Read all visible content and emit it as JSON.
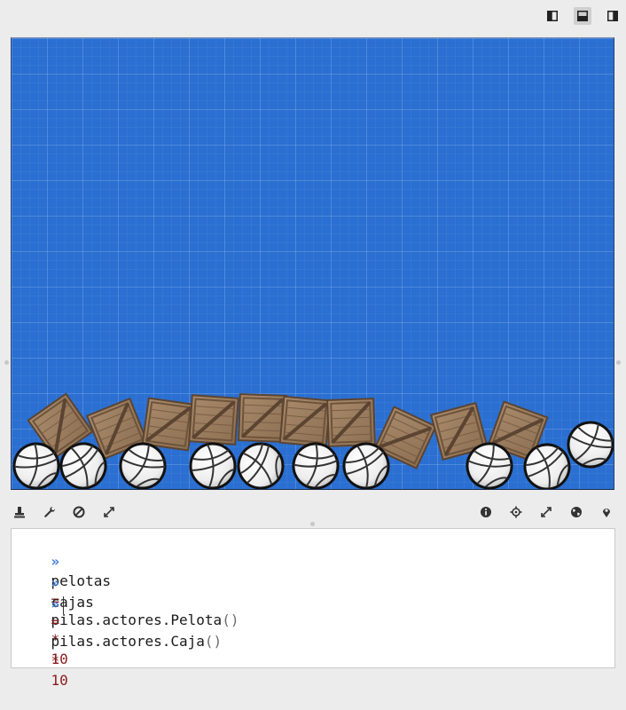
{
  "layout_buttons": [
    {
      "name": "layout-left-panel-icon",
      "active": false
    },
    {
      "name": "layout-bottom-panel-icon",
      "active": true
    },
    {
      "name": "layout-right-panel-icon",
      "active": false
    }
  ],
  "canvas": {
    "background_color": "#2a6fd1",
    "balls": 10,
    "boxes": 10
  },
  "toolbar_left": [
    "stamp-icon",
    "wrench-icon",
    "block-icon",
    "expand-icon"
  ],
  "toolbar_right": [
    "info-icon",
    "crosshair-icon",
    "resize-icon",
    "globe-icon",
    "map-pin-icon"
  ],
  "console": {
    "lines": [
      {
        "prompt": "»",
        "name": "pelotas",
        "op": "=",
        "expr": "pilas.actores.Pelota",
        "parens": "()",
        "mult": "*",
        "num": "10"
      },
      {
        "prompt": "»",
        "name": "cajas",
        "op": "=",
        "expr": "pilas.actores.Caja",
        "parens": "()",
        "mult": "*",
        "num": "10"
      }
    ],
    "input_prompt": "»",
    "input_value": ""
  }
}
